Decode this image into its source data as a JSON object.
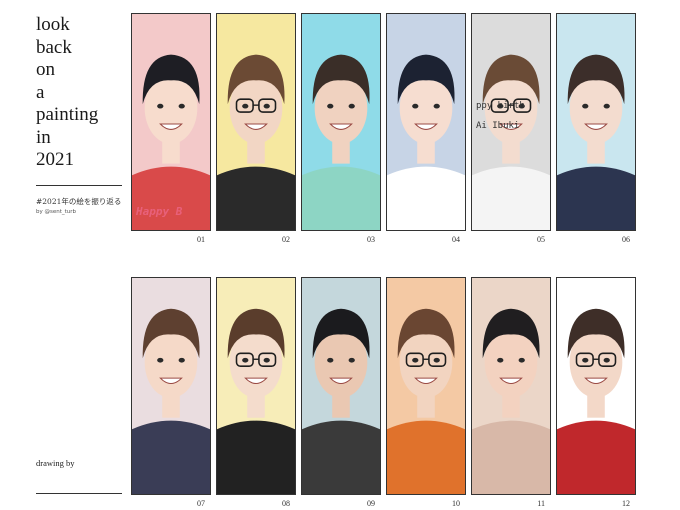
{
  "title_lines": [
    "look",
    "back",
    "on",
    "a",
    "painting",
    "in",
    "2021"
  ],
  "hashtag": "#2021年の絵を振り返る",
  "handle": "by @sent_turb",
  "footer_label": "drawing by",
  "panels": [
    {
      "number": "01",
      "caption": "Happy B",
      "bg": "#f3c9c9",
      "skin": "#f7dccd",
      "hair": "#1e1e24",
      "top": "#d94a4a",
      "captionColor": "#e8607a"
    },
    {
      "number": "02",
      "caption": "",
      "bg": "#f6e8a0",
      "skin": "#f2d6c4",
      "hair": "#6b4a34",
      "top": "#2a2a2a",
      "glasses": true
    },
    {
      "number": "03",
      "caption": "",
      "bg": "#8fdbe8",
      "skin": "#f0d2c0",
      "hair": "#3a2e28",
      "top": "#8dd5c4"
    },
    {
      "number": "04",
      "caption": "",
      "bg": "#c7d4e6",
      "skin": "#f6ddd0",
      "hair": "#1c2232",
      "top": "#ffffff"
    },
    {
      "number": "05",
      "caption": "ppy birth / Ai Ibuki",
      "bg": "#dcdcdc",
      "skin": "#f3dccf",
      "hair": "#6a4b36",
      "top": "#f4f4f4",
      "glasses": true,
      "captionColor": "#333333"
    },
    {
      "number": "06",
      "caption": "",
      "bg": "#c9e6ef",
      "skin": "#f3dccf",
      "hair": "#3c2e2a",
      "top": "#2c3550"
    },
    {
      "number": "07",
      "caption": "",
      "bg": "#eadde0",
      "skin": "#f5d9c8",
      "hair": "#5e4030",
      "top": "#3a3d56"
    },
    {
      "number": "08",
      "caption": "",
      "bg": "#f7edb8",
      "skin": "#f4dccc",
      "hair": "#5a3d2c",
      "top": "#222222",
      "glasses": true
    },
    {
      "number": "09",
      "caption": "",
      "bg": "#c4d7dc",
      "skin": "#eac8b2",
      "hair": "#1b1b1e",
      "top": "#3a3a3a"
    },
    {
      "number": "10",
      "caption": "",
      "bg": "#f4c9a4",
      "skin": "#f2d4c0",
      "hair": "#6a4632",
      "top": "#e0722c",
      "glasses": true
    },
    {
      "number": "11",
      "caption": "",
      "bg": "#ebd6c8",
      "skin": "#f3d2c0",
      "hair": "#201e20",
      "top": "#d8b8a8"
    },
    {
      "number": "12",
      "caption": "",
      "bg": "#ffffff",
      "skin": "#f3d8c8",
      "hair": "#3e2e28",
      "top": "#c0282c",
      "glasses": true
    }
  ]
}
